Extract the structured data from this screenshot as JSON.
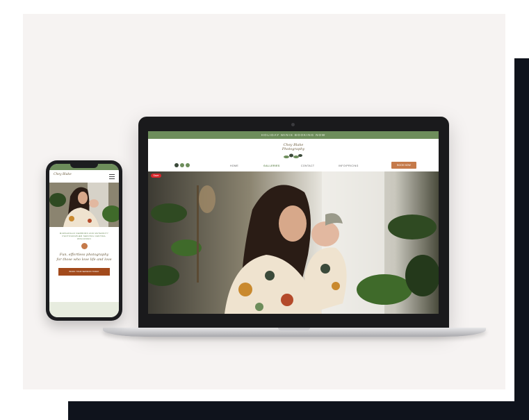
{
  "website": {
    "banner_text": "HOLIDAY MINIS BOOKING NOW",
    "logo": "Chey Blake Photography",
    "nav": [
      "HOME",
      "GALLERIES",
      "CONTACT",
      "INFO/PRICING"
    ],
    "cta_label": "BOOK NOW",
    "pin_badge": "Save"
  },
  "phone": {
    "logo": "Chey Blake",
    "caps_text": "MARSHFIELD NEWBORN AND MATERNITY PHOTOGRAPHER SERVING CENTRAL WISCONSIN",
    "tagline_1": "Fun, effortless photography",
    "tagline_2": "for those who love life and love",
    "cta_label": "BOOK YOUR SESSION TODAY"
  },
  "colors": {
    "brand_green": "#6d8d5b",
    "accent_copper": "#c57a4a",
    "dark_panel": "#0f131c"
  },
  "icons": [
    "menu-icon",
    "instagram-icon",
    "facebook-icon",
    "pinterest-icon",
    "camera-icon"
  ]
}
